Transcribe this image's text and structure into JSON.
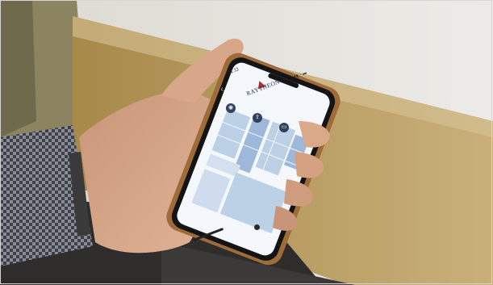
{
  "photo": {
    "subject": "phone-held-in-hand",
    "colors": {
      "wall": "#e6e4de",
      "wall_stripe": "#b89a5a",
      "left_wall": "#8c8460",
      "floor": "#2e2d2c",
      "skin": "#d9a98a",
      "shirt_check": "#3c3f47",
      "phone_case": "#9e6b3b",
      "phone_body": "#141414",
      "screen_bg": "#f4f7fb",
      "map_block": "#bcd0e6",
      "map_block_dark": "#9db8d8",
      "nav_button": "#31405e"
    }
  },
  "app": {
    "status_time": "11:11",
    "status_icons": "▮▮ ◔ ▬",
    "back_icon": "back-arrow-icon",
    "brand_name": "RAYTHEON",
    "brand_subtitle": "",
    "nav_buttons": [
      {
        "icon": "directory-icon",
        "glyph": "◉",
        "label": ""
      },
      {
        "icon": "navigation-icon",
        "glyph": "⇧",
        "label": ""
      },
      {
        "icon": "transit-icon",
        "glyph": "▭",
        "label": ""
      }
    ],
    "map": {
      "labels": []
    }
  }
}
